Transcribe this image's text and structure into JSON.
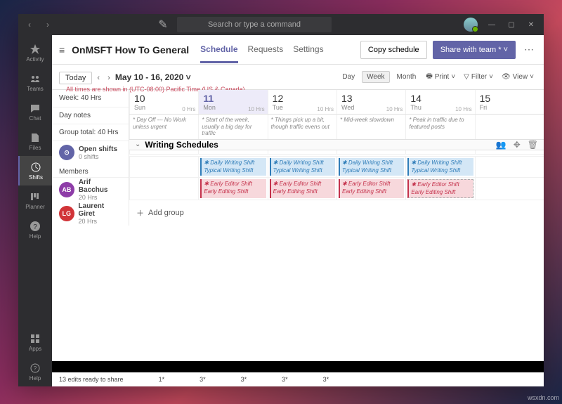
{
  "search_placeholder": "Search or type a command",
  "rail": [
    "Activity",
    "Teams",
    "Chat",
    "Files",
    "Shifts",
    "Planner",
    "Help",
    "Apps",
    "Help"
  ],
  "title": "OnMSFT How To General",
  "tabs": [
    "Schedule",
    "Requests",
    "Settings"
  ],
  "copy_btn": "Copy schedule",
  "share_btn": "Share with team *",
  "today": "Today",
  "date_range": "May 10 - 16, 2020",
  "tz": "All times are shown in (UTC-08:00) Pacific Time (US & Canada).",
  "views": [
    "Day",
    "Week",
    "Month"
  ],
  "tools": [
    "Print",
    "Filter",
    "View"
  ],
  "days": [
    {
      "num": "10",
      "name": "Sun",
      "hrs": "0 Hrs",
      "note": "Day Off --- No Work unless urgent"
    },
    {
      "num": "11",
      "name": "Mon",
      "hrs": "10 Hrs",
      "note": "Start of the week, usually a big day for traffic",
      "sel": true
    },
    {
      "num": "12",
      "name": "Tue",
      "hrs": "10 Hrs",
      "note": "Things pick up a bit, though traffic evens out"
    },
    {
      "num": "13",
      "name": "Wed",
      "hrs": "10 Hrs",
      "note": "Mid-week slowdown"
    },
    {
      "num": "14",
      "name": "Thu",
      "hrs": "10 Hrs",
      "note": "Peak in traffic due to featured posts"
    },
    {
      "num": "15",
      "name": "Fri",
      "hrs": "",
      "note": ""
    }
  ],
  "side": {
    "week": "Week: 40 Hrs",
    "daynotes": "Day notes",
    "group_total": "Group total: 40 Hrs",
    "open_shifts": "Open shifts",
    "open_sub": "0 shifts",
    "members": "Members"
  },
  "sched_title": "Writing Schedules",
  "members": [
    {
      "init": "AB",
      "name": "Arif Bacchus",
      "hrs": "20 Hrs"
    },
    {
      "init": "LG",
      "name": "Laurent Giret",
      "hrs": "20 Hrs"
    }
  ],
  "shift_blue": {
    "l1": "Daily Writing Shift",
    "l2": "Typical Writing Shift"
  },
  "shift_pink": {
    "l1": "Early Editor Shift",
    "l2": "Early Editing Shift"
  },
  "add_group": "Add group",
  "footer": {
    "status": "13 edits ready to share",
    "marks": [
      "1*",
      "3*",
      "3*",
      "3*",
      "3*"
    ]
  },
  "watermark": "wsxdn.com"
}
